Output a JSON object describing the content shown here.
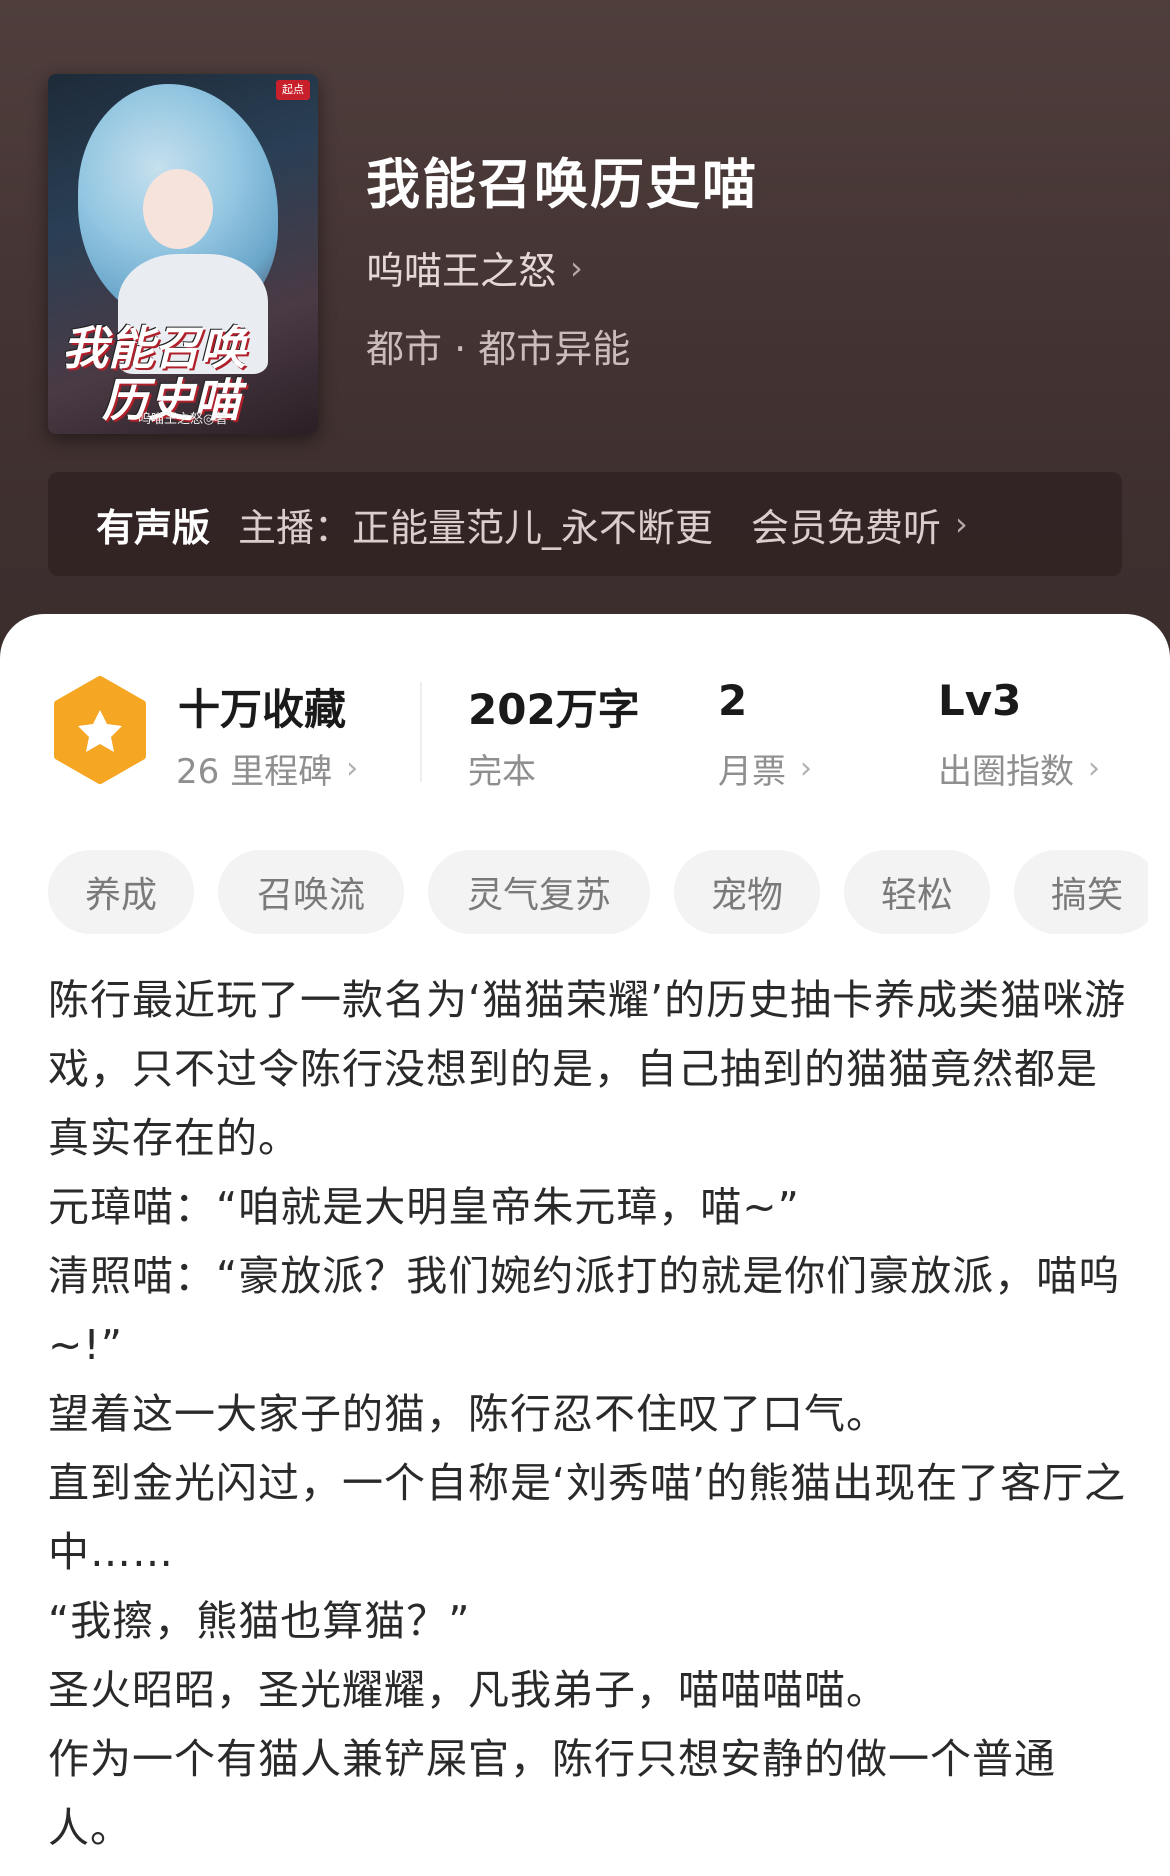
{
  "book": {
    "title": "我能召唤历史喵",
    "author": "呜喵王之怒",
    "genre": "都市 · 都市异能"
  },
  "cover": {
    "title_line1": "我能召唤",
    "title_line2": "历史喵",
    "author_caption": "呜喵王之怒◎著"
  },
  "audio": {
    "tag": "有声版",
    "host": "主播：正能量范儿_永不断更",
    "free": "会员免费听"
  },
  "stats": {
    "collect_main": "十万收藏",
    "collect_sub": "26 里程碑",
    "words_main": "202万字",
    "words_sub": "完本",
    "tickets_main": "2",
    "tickets_sub": "月票",
    "level_main": "Lv3",
    "level_sub": "出圈指数"
  },
  "tags": [
    "养成",
    "召唤流",
    "灵气复苏",
    "宠物",
    "轻松",
    "搞笑"
  ],
  "description": [
    "陈行最近玩了一款名为‘猫猫荣耀’的历史抽卡养成类猫咪游戏，只不过令陈行没想到的是，自己抽到的猫猫竟然都是真实存在的。",
    "元璋喵：“咱就是大明皇帝朱元璋，喵~”",
    "清照喵：“豪放派？我们婉约派打的就是你们豪放派，喵呜~!”",
    "望着这一大家子的猫，陈行忍不住叹了口气。",
    "直到金光闪过，一个自称是‘刘秀喵’的熊猫出现在了客厅之中……",
    "“我擦，熊猫也算猫？”",
    "圣火昭昭，圣光耀耀，凡我弟子，喵喵喵喵。",
    "作为一个有猫人兼铲屎官，陈行只想安静的做一个普通人。"
  ],
  "colors": {
    "hero_bg": "#4a3a39",
    "badge_orange": "#f5a623",
    "tag_bg": "#f3f3f3"
  }
}
